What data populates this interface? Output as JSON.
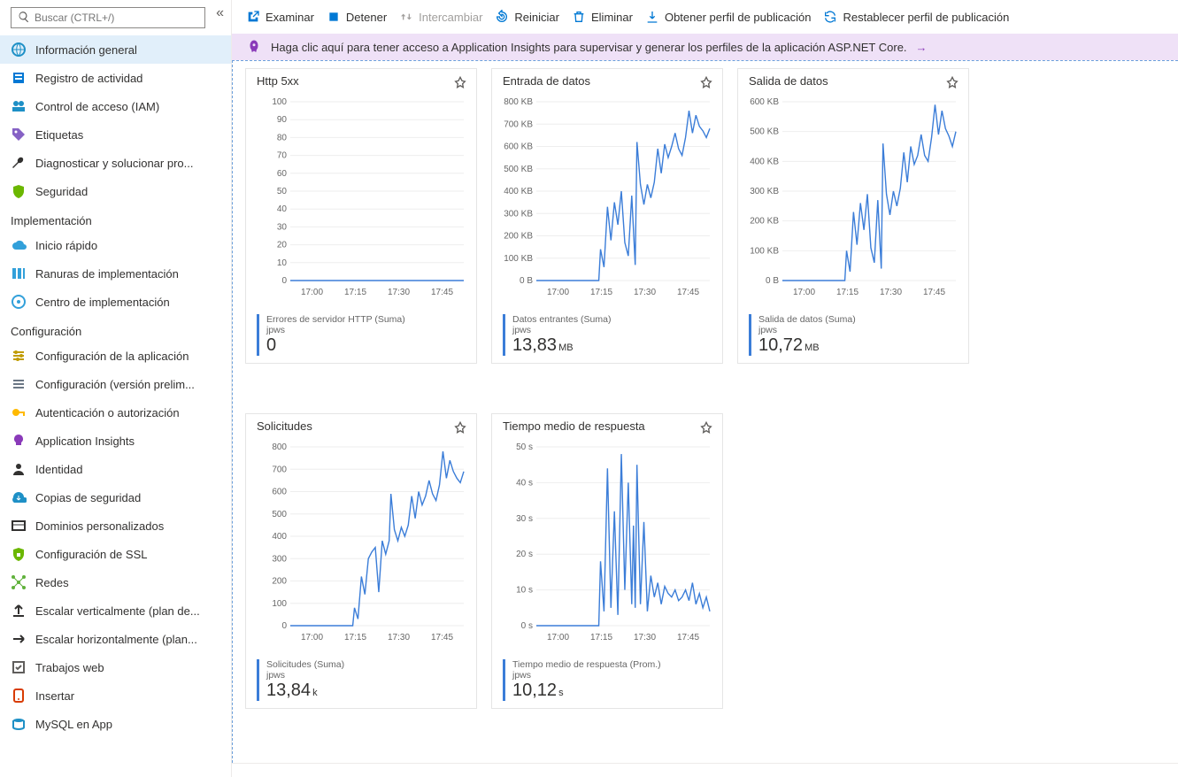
{
  "search": {
    "placeholder": "Buscar (CTRL+/)"
  },
  "nav": {
    "items": [
      {
        "label": "Información general",
        "icon": "globe",
        "color": "#1e90c6",
        "active": true
      },
      {
        "label": "Registro de actividad",
        "icon": "log",
        "color": "#0078d4"
      },
      {
        "label": "Control de acceso (IAM)",
        "icon": "iam",
        "color": "#1e90c6"
      },
      {
        "label": "Etiquetas",
        "icon": "tag",
        "color": "#8661c5"
      },
      {
        "label": "Diagnosticar y solucionar pro...",
        "icon": "wrench",
        "color": "#323130"
      },
      {
        "label": "Seguridad",
        "icon": "shield",
        "color": "#6bb700"
      }
    ]
  },
  "group_impl": {
    "title": "Implementación",
    "items": [
      {
        "label": "Inicio rápido",
        "icon": "cloud",
        "color": "#32a0da"
      },
      {
        "label": "Ranuras de implementación",
        "icon": "slots",
        "color": "#32a0da"
      },
      {
        "label": "Centro de implementación",
        "icon": "center",
        "color": "#32a0da"
      }
    ]
  },
  "group_conf": {
    "title": "Configuración",
    "items": [
      {
        "label": "Configuración de la aplicación",
        "icon": "sliders",
        "color": "#c19c00"
      },
      {
        "label": "Configuración (versión prelim...",
        "icon": "sliders2",
        "color": "#6b7785"
      },
      {
        "label": "Autenticación o autorización",
        "icon": "key",
        "color": "#ffb900"
      },
      {
        "label": "Application Insights",
        "icon": "bulb",
        "color": "#8a3ab9"
      },
      {
        "label": "Identidad",
        "icon": "identity",
        "color": "#323130"
      },
      {
        "label": "Copias de seguridad",
        "icon": "backup",
        "color": "#1e90c6"
      },
      {
        "label": "Dominios personalizados",
        "icon": "domain",
        "color": "#323130"
      },
      {
        "label": "Configuración de SSL",
        "icon": "ssl",
        "color": "#6bb700"
      },
      {
        "label": "Redes",
        "icon": "network",
        "color": "#5fb13a"
      },
      {
        "label": "Escalar verticalmente (plan de...",
        "icon": "scaleup",
        "color": "#323130"
      },
      {
        "label": "Escalar horizontalmente (plan...",
        "icon": "scaleout",
        "color": "#323130"
      },
      {
        "label": "Trabajos web",
        "icon": "webjobs",
        "color": "#605e5c"
      },
      {
        "label": "Insertar",
        "icon": "push",
        "color": "#d83b01"
      },
      {
        "label": "MySQL en App",
        "icon": "mysql",
        "color": "#1e90c6"
      }
    ]
  },
  "toolbar": {
    "examine": "Examinar",
    "stop": "Detener",
    "swap": "Intercambiar",
    "restart": "Reiniciar",
    "delete": "Eliminar",
    "getprofile": "Obtener perfil de publicación",
    "resetprofile": "Restablecer perfil de publicación"
  },
  "banner": {
    "text": "Haga clic aquí para tener acceso a Application Insights para supervisar y generar los perfiles de la aplicación ASP.NET Core."
  },
  "cards": [
    {
      "id": "http5xx",
      "title": "Http 5xx",
      "legend_label": "Errores de servidor HTTP (Suma)",
      "legend_sub": "jpws",
      "legend_value": "0",
      "legend_unit": ""
    },
    {
      "id": "data_in",
      "title": "Entrada de datos",
      "legend_label": "Datos entrantes (Suma)",
      "legend_sub": "jpws",
      "legend_value": "13,83",
      "legend_unit": "MB"
    },
    {
      "id": "data_out",
      "title": "Salida de datos",
      "legend_label": "Salida de datos (Suma)",
      "legend_sub": "jpws",
      "legend_value": "10,72",
      "legend_unit": "MB"
    },
    {
      "id": "requests",
      "title": "Solicitudes",
      "legend_label": "Solicitudes (Suma)",
      "legend_sub": "jpws",
      "legend_value": "13,84",
      "legend_unit": "k"
    },
    {
      "id": "resp_time",
      "title": "Tiempo medio de respuesta",
      "legend_label": "Tiempo medio de respuesta (Prom.)",
      "legend_sub": "jpws",
      "legend_value": "10,12",
      "legend_unit": "s"
    }
  ],
  "chart_data": [
    {
      "id": "http5xx",
      "type": "line",
      "xlabel": "",
      "ylabel": "",
      "x_ticks": [
        "17:00",
        "17:15",
        "17:30",
        "17:45"
      ],
      "y_ticks": [
        0,
        10,
        20,
        30,
        40,
        50,
        60,
        70,
        80,
        90,
        100
      ],
      "ylim": [
        0,
        100
      ],
      "series": [
        {
          "name": "http5xx",
          "values": [
            [
              0,
              0
            ],
            [
              100,
              0
            ]
          ]
        }
      ]
    },
    {
      "id": "data_in",
      "type": "line",
      "x_ticks": [
        "17:00",
        "17:15",
        "17:30",
        "17:45"
      ],
      "y_ticks": [
        "0 B",
        "100 KB",
        "200 KB",
        "300 KB",
        "400 KB",
        "500 KB",
        "600 KB",
        "700 KB",
        "800 KB"
      ],
      "ylim": [
        0,
        800
      ],
      "series": [
        {
          "name": "data_in",
          "values": [
            [
              0,
              0
            ],
            [
              36,
              0
            ],
            [
              37,
              140
            ],
            [
              39,
              60
            ],
            [
              41,
              330
            ],
            [
              43,
              180
            ],
            [
              45,
              350
            ],
            [
              47,
              250
            ],
            [
              49,
              400
            ],
            [
              51,
              170
            ],
            [
              53,
              110
            ],
            [
              55,
              380
            ],
            [
              57,
              70
            ],
            [
              58,
              620
            ],
            [
              60,
              430
            ],
            [
              62,
              340
            ],
            [
              64,
              430
            ],
            [
              66,
              370
            ],
            [
              68,
              440
            ],
            [
              70,
              590
            ],
            [
              72,
              480
            ],
            [
              74,
              610
            ],
            [
              76,
              550
            ],
            [
              78,
              600
            ],
            [
              80,
              660
            ],
            [
              82,
              590
            ],
            [
              84,
              560
            ],
            [
              86,
              640
            ],
            [
              88,
              760
            ],
            [
              90,
              660
            ],
            [
              92,
              740
            ],
            [
              94,
              690
            ],
            [
              96,
              670
            ],
            [
              98,
              640
            ],
            [
              100,
              680
            ]
          ]
        }
      ]
    },
    {
      "id": "data_out",
      "type": "line",
      "x_ticks": [
        "17:00",
        "17:15",
        "17:30",
        "17:45"
      ],
      "y_ticks": [
        "0 B",
        "100 KB",
        "200 KB",
        "300 KB",
        "400 KB",
        "500 KB",
        "600 KB"
      ],
      "ylim": [
        0,
        600
      ],
      "series": [
        {
          "name": "data_out",
          "values": [
            [
              0,
              0
            ],
            [
              36,
              0
            ],
            [
              37,
              100
            ],
            [
              39,
              30
            ],
            [
              41,
              230
            ],
            [
              43,
              120
            ],
            [
              45,
              260
            ],
            [
              47,
              170
            ],
            [
              49,
              290
            ],
            [
              51,
              110
            ],
            [
              53,
              60
            ],
            [
              55,
              270
            ],
            [
              57,
              40
            ],
            [
              58,
              460
            ],
            [
              60,
              290
            ],
            [
              62,
              220
            ],
            [
              64,
              300
            ],
            [
              66,
              250
            ],
            [
              68,
              310
            ],
            [
              70,
              430
            ],
            [
              72,
              330
            ],
            [
              74,
              450
            ],
            [
              76,
              390
            ],
            [
              78,
              420
            ],
            [
              80,
              490
            ],
            [
              82,
              420
            ],
            [
              84,
              400
            ],
            [
              86,
              480
            ],
            [
              88,
              590
            ],
            [
              90,
              490
            ],
            [
              92,
              570
            ],
            [
              94,
              510
            ],
            [
              96,
              485
            ],
            [
              98,
              450
            ],
            [
              100,
              500
            ]
          ]
        }
      ]
    },
    {
      "id": "requests",
      "type": "line",
      "x_ticks": [
        "17:00",
        "17:15",
        "17:30",
        "17:45"
      ],
      "y_ticks": [
        0,
        100,
        200,
        300,
        400,
        500,
        600,
        700,
        800
      ],
      "ylim": [
        0,
        800
      ],
      "series": [
        {
          "name": "requests",
          "values": [
            [
              0,
              0
            ],
            [
              36,
              0
            ],
            [
              37,
              80
            ],
            [
              39,
              30
            ],
            [
              41,
              220
            ],
            [
              43,
              140
            ],
            [
              45,
              300
            ],
            [
              47,
              330
            ],
            [
              49,
              350
            ],
            [
              51,
              150
            ],
            [
              53,
              380
            ],
            [
              55,
              320
            ],
            [
              57,
              380
            ],
            [
              58,
              590
            ],
            [
              60,
              430
            ],
            [
              62,
              380
            ],
            [
              64,
              440
            ],
            [
              66,
              400
            ],
            [
              68,
              450
            ],
            [
              70,
              580
            ],
            [
              72,
              480
            ],
            [
              74,
              600
            ],
            [
              76,
              540
            ],
            [
              78,
              580
            ],
            [
              80,
              650
            ],
            [
              82,
              590
            ],
            [
              84,
              560
            ],
            [
              86,
              630
            ],
            [
              88,
              780
            ],
            [
              90,
              660
            ],
            [
              92,
              740
            ],
            [
              94,
              690
            ],
            [
              96,
              660
            ],
            [
              98,
              640
            ],
            [
              100,
              690
            ]
          ]
        }
      ]
    },
    {
      "id": "resp_time",
      "type": "line",
      "x_ticks": [
        "17:00",
        "17:15",
        "17:30",
        "17:45"
      ],
      "y_ticks": [
        "0 s",
        "10 s",
        "20 s",
        "30 s",
        "40 s",
        "50 s"
      ],
      "ylim": [
        0,
        50
      ],
      "series": [
        {
          "name": "resp_time",
          "values": [
            [
              0,
              0
            ],
            [
              36,
              0
            ],
            [
              37,
              18
            ],
            [
              39,
              4
            ],
            [
              41,
              44
            ],
            [
              43,
              5
            ],
            [
              45,
              32
            ],
            [
              47,
              3
            ],
            [
              49,
              48
            ],
            [
              51,
              10
            ],
            [
              53,
              40
            ],
            [
              55,
              6
            ],
            [
              56,
              28
            ],
            [
              57,
              5
            ],
            [
              58,
              45
            ],
            [
              60,
              6
            ],
            [
              62,
              29
            ],
            [
              64,
              4
            ],
            [
              66,
              14
            ],
            [
              68,
              8
            ],
            [
              70,
              12
            ],
            [
              72,
              6
            ],
            [
              74,
              11
            ],
            [
              76,
              9
            ],
            [
              78,
              8
            ],
            [
              80,
              10
            ],
            [
              82,
              7
            ],
            [
              84,
              8
            ],
            [
              86,
              10
            ],
            [
              88,
              7
            ],
            [
              90,
              12
            ],
            [
              92,
              6
            ],
            [
              94,
              9
            ],
            [
              96,
              5
            ],
            [
              98,
              8
            ],
            [
              100,
              4
            ]
          ]
        }
      ]
    }
  ]
}
